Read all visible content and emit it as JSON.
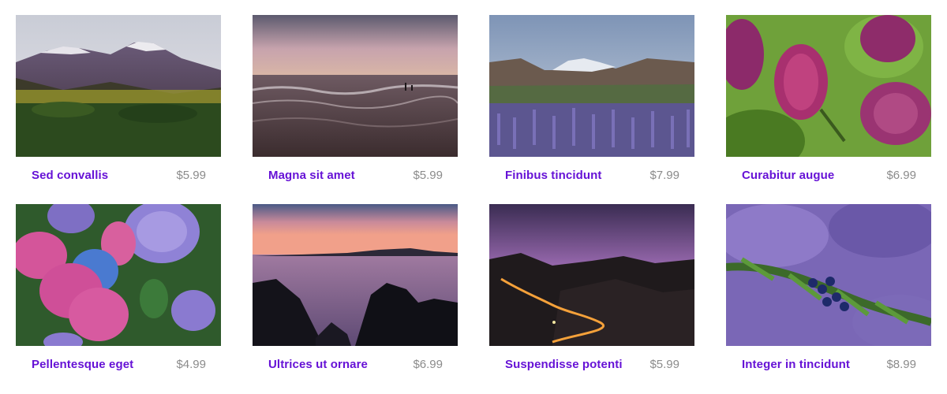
{
  "products": [
    {
      "title": "Sed convallis",
      "price": "$5.99",
      "image": "mountain-forest-photo"
    },
    {
      "title": "Magna sit amet",
      "price": "$5.99",
      "image": "ocean-waves-photo"
    },
    {
      "title": "Finibus tincidunt",
      "price": "$7.99",
      "image": "lupine-valley-photo"
    },
    {
      "title": "Curabitur augue",
      "price": "$6.99",
      "image": "lilac-flowers-photo"
    },
    {
      "title": "Pellentesque eget",
      "price": "$4.99",
      "image": "hydrangea-photo"
    },
    {
      "title": "Ultrices ut ornare",
      "price": "$6.99",
      "image": "sunset-lake-photo"
    },
    {
      "title": "Suspendisse potenti",
      "price": "$5.99",
      "image": "night-road-photo"
    },
    {
      "title": "Integer in tincidunt",
      "price": "$8.99",
      "image": "juniper-berries-photo"
    }
  ],
  "colors": {
    "title": "#6612d6",
    "price": "#8b8b8b",
    "background": "#ffffff"
  }
}
